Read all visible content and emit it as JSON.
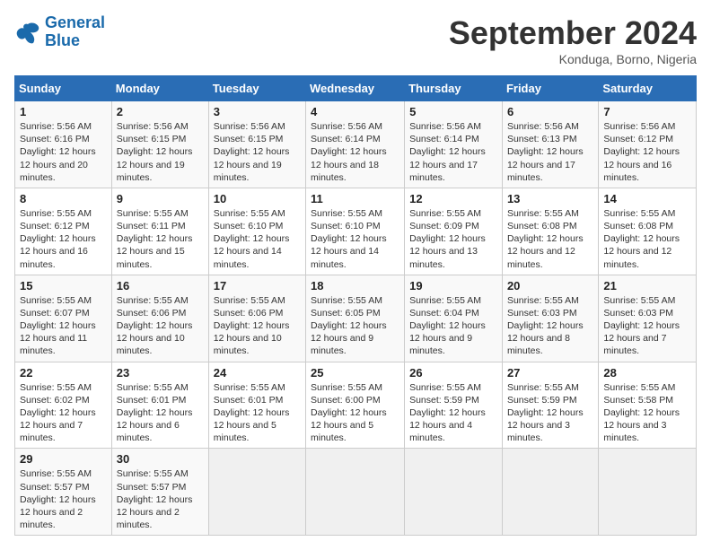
{
  "logo": {
    "line1": "General",
    "line2": "Blue"
  },
  "title": "September 2024",
  "location": "Konduga, Borno, Nigeria",
  "headers": [
    "Sunday",
    "Monday",
    "Tuesday",
    "Wednesday",
    "Thursday",
    "Friday",
    "Saturday"
  ],
  "weeks": [
    [
      {
        "num": "1",
        "rise": "5:56 AM",
        "set": "6:16 PM",
        "daylight": "12 hours and 20 minutes."
      },
      {
        "num": "2",
        "rise": "5:56 AM",
        "set": "6:15 PM",
        "daylight": "12 hours and 19 minutes."
      },
      {
        "num": "3",
        "rise": "5:56 AM",
        "set": "6:15 PM",
        "daylight": "12 hours and 19 minutes."
      },
      {
        "num": "4",
        "rise": "5:56 AM",
        "set": "6:14 PM",
        "daylight": "12 hours and 18 minutes."
      },
      {
        "num": "5",
        "rise": "5:56 AM",
        "set": "6:14 PM",
        "daylight": "12 hours and 17 minutes."
      },
      {
        "num": "6",
        "rise": "5:56 AM",
        "set": "6:13 PM",
        "daylight": "12 hours and 17 minutes."
      },
      {
        "num": "7",
        "rise": "5:56 AM",
        "set": "6:12 PM",
        "daylight": "12 hours and 16 minutes."
      }
    ],
    [
      {
        "num": "8",
        "rise": "5:55 AM",
        "set": "6:12 PM",
        "daylight": "12 hours and 16 minutes."
      },
      {
        "num": "9",
        "rise": "5:55 AM",
        "set": "6:11 PM",
        "daylight": "12 hours and 15 minutes."
      },
      {
        "num": "10",
        "rise": "5:55 AM",
        "set": "6:10 PM",
        "daylight": "12 hours and 14 minutes."
      },
      {
        "num": "11",
        "rise": "5:55 AM",
        "set": "6:10 PM",
        "daylight": "12 hours and 14 minutes."
      },
      {
        "num": "12",
        "rise": "5:55 AM",
        "set": "6:09 PM",
        "daylight": "12 hours and 13 minutes."
      },
      {
        "num": "13",
        "rise": "5:55 AM",
        "set": "6:08 PM",
        "daylight": "12 hours and 12 minutes."
      },
      {
        "num": "14",
        "rise": "5:55 AM",
        "set": "6:08 PM",
        "daylight": "12 hours and 12 minutes."
      }
    ],
    [
      {
        "num": "15",
        "rise": "5:55 AM",
        "set": "6:07 PM",
        "daylight": "12 hours and 11 minutes."
      },
      {
        "num": "16",
        "rise": "5:55 AM",
        "set": "6:06 PM",
        "daylight": "12 hours and 10 minutes."
      },
      {
        "num": "17",
        "rise": "5:55 AM",
        "set": "6:06 PM",
        "daylight": "12 hours and 10 minutes."
      },
      {
        "num": "18",
        "rise": "5:55 AM",
        "set": "6:05 PM",
        "daylight": "12 hours and 9 minutes."
      },
      {
        "num": "19",
        "rise": "5:55 AM",
        "set": "6:04 PM",
        "daylight": "12 hours and 9 minutes."
      },
      {
        "num": "20",
        "rise": "5:55 AM",
        "set": "6:03 PM",
        "daylight": "12 hours and 8 minutes."
      },
      {
        "num": "21",
        "rise": "5:55 AM",
        "set": "6:03 PM",
        "daylight": "12 hours and 7 minutes."
      }
    ],
    [
      {
        "num": "22",
        "rise": "5:55 AM",
        "set": "6:02 PM",
        "daylight": "12 hours and 7 minutes."
      },
      {
        "num": "23",
        "rise": "5:55 AM",
        "set": "6:01 PM",
        "daylight": "12 hours and 6 minutes."
      },
      {
        "num": "24",
        "rise": "5:55 AM",
        "set": "6:01 PM",
        "daylight": "12 hours and 5 minutes."
      },
      {
        "num": "25",
        "rise": "5:55 AM",
        "set": "6:00 PM",
        "daylight": "12 hours and 5 minutes."
      },
      {
        "num": "26",
        "rise": "5:55 AM",
        "set": "5:59 PM",
        "daylight": "12 hours and 4 minutes."
      },
      {
        "num": "27",
        "rise": "5:55 AM",
        "set": "5:59 PM",
        "daylight": "12 hours and 3 minutes."
      },
      {
        "num": "28",
        "rise": "5:55 AM",
        "set": "5:58 PM",
        "daylight": "12 hours and 3 minutes."
      }
    ],
    [
      {
        "num": "29",
        "rise": "5:55 AM",
        "set": "5:57 PM",
        "daylight": "12 hours and 2 minutes."
      },
      {
        "num": "30",
        "rise": "5:55 AM",
        "set": "5:57 PM",
        "daylight": "12 hours and 2 minutes."
      },
      null,
      null,
      null,
      null,
      null
    ]
  ]
}
